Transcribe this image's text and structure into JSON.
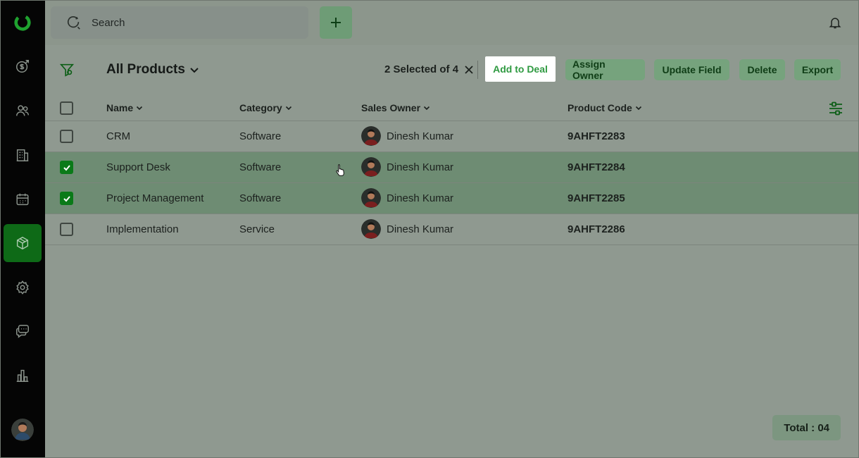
{
  "search": {
    "placeholder": "Search"
  },
  "toolbar": {
    "title": "All Products",
    "selected_text": "2 Selected of 4",
    "actions": {
      "add_to_deal": "Add to Deal",
      "assign_owner": "Assign Owner",
      "update_field": "Update Field",
      "delete": "Delete",
      "export": "Export"
    }
  },
  "table": {
    "headers": {
      "name": "Name",
      "category": "Category",
      "owner": "Sales Owner",
      "code": "Product Code"
    },
    "rows": [
      {
        "name": "CRM",
        "category": "Software",
        "owner": "Dinesh Kumar",
        "code": "9AHFT2283",
        "selected": false
      },
      {
        "name": "Support Desk",
        "category": "Software",
        "owner": "Dinesh Kumar",
        "code": "9AHFT2284",
        "selected": true
      },
      {
        "name": "Project Management",
        "category": "Software",
        "owner": "Dinesh Kumar",
        "code": "9AHFT2285",
        "selected": true
      },
      {
        "name": "Implementation",
        "category": "Service",
        "owner": "Dinesh Kumar",
        "code": "9AHFT2286",
        "selected": false
      }
    ]
  },
  "footer": {
    "total": "Total : 04"
  },
  "sidebar": {
    "items": [
      "deals-icon",
      "contacts-icon",
      "companies-icon",
      "calendar-icon",
      "products-icon",
      "settings-icon",
      "chat-icon",
      "reports-icon"
    ],
    "active": "products-icon"
  },
  "colors": {
    "brand": "#0e6a17",
    "accent": "#2f9a41",
    "sidebar": "#050505"
  }
}
